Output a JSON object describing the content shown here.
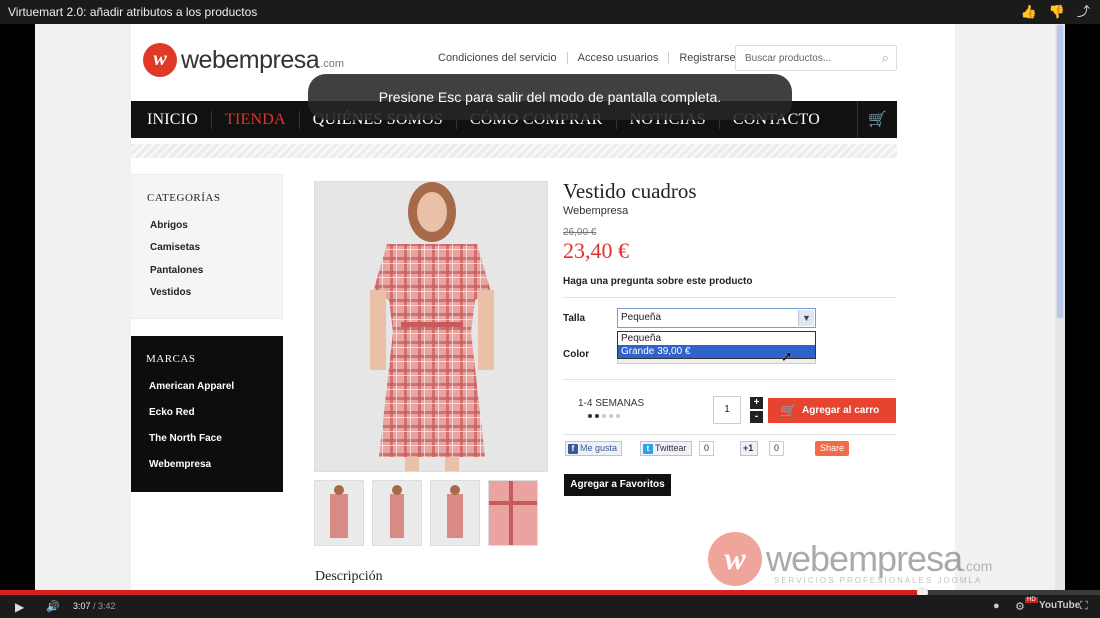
{
  "player": {
    "title": "Virtuemart 2.0: añadir atributos a los productos",
    "time_current": "3:07",
    "time_total": "/ 3:42",
    "progress_fraction": 0.838,
    "toast": "Presione Esc para salir del modo de pantalla completa.",
    "icons": [
      "thumbs-up-icon",
      "thumbs-down-icon",
      "share-icon",
      "play-icon",
      "volume-icon",
      "info-icon",
      "settings-icon",
      "youtube-logo",
      "fullscreen-icon"
    ],
    "hd_badge": "HD",
    "youtube_label": "YouTube"
  },
  "site": {
    "logo_text": "webempresa",
    "logo_domain": ".com",
    "top_links": [
      "Condiciones del servicio",
      "Acceso usuarios",
      "Registrarse"
    ],
    "search_placeholder": "Buscar productos...",
    "nav": [
      "INICIO",
      "TIENDA",
      "QUIÉNES SOMOS",
      "CÓMO COMPRAR",
      "NOTICIAS",
      "CONTACTO"
    ],
    "nav_active": "TIENDA",
    "accent": "#e0322c"
  },
  "categories": {
    "title": "CATEGORÍAS",
    "items": [
      "Abrigos",
      "Camisetas",
      "Pantalones",
      "Vestidos"
    ]
  },
  "brands": {
    "title": "MARCAS",
    "items": [
      "American Apparel",
      "Ecko Red",
      "The North Face",
      "Webempresa"
    ]
  },
  "product": {
    "name": "Vestido cuadros",
    "brand": "Webempresa",
    "old_price": "26,00 €",
    "price": "23,40 €",
    "ask": "Haga una pregunta sobre este producto",
    "size_label": "Talla",
    "size_selected": "Pequeña",
    "size_options": [
      "Pequeña",
      "Grande 39,00 €"
    ],
    "size_highlighted": "Grande 39,00 €",
    "color_label": "Color",
    "shipping": "1-4 SEMANAS",
    "quantity": "1",
    "plus": "+",
    "minus": "-",
    "add_to_cart": "Agregar al carro",
    "favorites": "Agregar a Favoritos",
    "description_title": "Descripción"
  },
  "social": {
    "facebook": "Me gusta",
    "twitter": "Twittear",
    "twitter_count": "0",
    "gplus": "+1",
    "gplus_count": "0",
    "share": "Share"
  },
  "watermark": {
    "text": "webempresa",
    "domain": ".com",
    "subtitle": "SERVICIOS PROFESIONALES JOOMLA"
  }
}
